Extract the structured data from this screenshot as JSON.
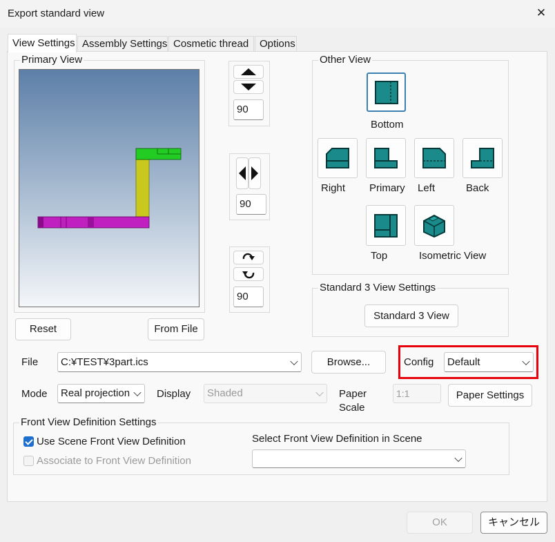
{
  "window": {
    "title": "Export standard view",
    "close_icon": "close-icon"
  },
  "tabs": [
    {
      "label": "View Settings",
      "active": true
    },
    {
      "label": "Assembly Settings",
      "active": false
    },
    {
      "label": "Cosmetic thread",
      "active": false
    },
    {
      "label": "Options",
      "active": false
    }
  ],
  "primary_view": {
    "title": "Primary View",
    "reset_label": "Reset",
    "from_file_label": "From File"
  },
  "rotation": {
    "vertical_value": "90",
    "horizontal_value": "90",
    "spin_value": "90"
  },
  "other_view": {
    "title": "Other View",
    "views": {
      "bottom": "Bottom",
      "right": "Right",
      "primary": "Primary",
      "left": "Left",
      "back": "Back",
      "top": "Top",
      "isometric": "Isometric View"
    }
  },
  "standard3": {
    "title": "Standard 3 View Settings",
    "button_label": "Standard 3 View"
  },
  "file_row": {
    "file_label": "File",
    "file_value": "C:¥TEST¥3part.ics",
    "browse_label": "Browse...",
    "config_label": "Config",
    "config_value": "Default"
  },
  "mode_row": {
    "mode_label": "Mode",
    "mode_value": "Real projection",
    "display_label": "Display",
    "display_value": "Shaded",
    "display_disabled": true,
    "paper_scale_label_1": "Paper",
    "paper_scale_label_2": "Scale",
    "paper_scale_value": "1:1",
    "paper_settings_label": "Paper Settings"
  },
  "front_view": {
    "title": "Front View Definition Settings",
    "use_scene_label": "Use Scene Front View Definition",
    "use_scene_checked": true,
    "associate_label": "Associate to Front View Definition",
    "associate_checked": false,
    "associate_disabled": true,
    "select_label": "Select Front View Definition in Scene",
    "select_value": ""
  },
  "footer": {
    "ok_label": "OK",
    "ok_disabled": true,
    "cancel_label": "キャンセル"
  },
  "colors": {
    "accent": "#1f6fcf",
    "highlight": "#e8000b",
    "view_icon": "#1a8a8a",
    "model_green": "#22cc22",
    "model_yellow": "#c8c81e",
    "model_magenta": "#c020c0"
  }
}
